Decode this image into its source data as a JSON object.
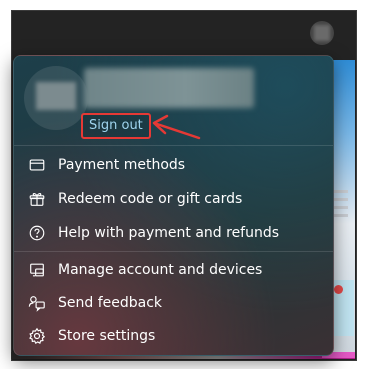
{
  "account": {
    "sign_out_label": "Sign out"
  },
  "menu": {
    "items": [
      {
        "label": "Payment methods",
        "icon": "credit-card-icon"
      },
      {
        "label": "Redeem code or gift cards",
        "icon": "gift-icon"
      },
      {
        "label": "Help with payment and refunds",
        "icon": "help-circle-icon"
      },
      {
        "label": "Manage account and devices",
        "icon": "devices-icon"
      },
      {
        "label": "Send feedback",
        "icon": "feedback-icon"
      },
      {
        "label": "Store settings",
        "icon": "gear-icon"
      }
    ]
  },
  "colors": {
    "highlight": "#e53935",
    "link": "#9fd4ee"
  }
}
